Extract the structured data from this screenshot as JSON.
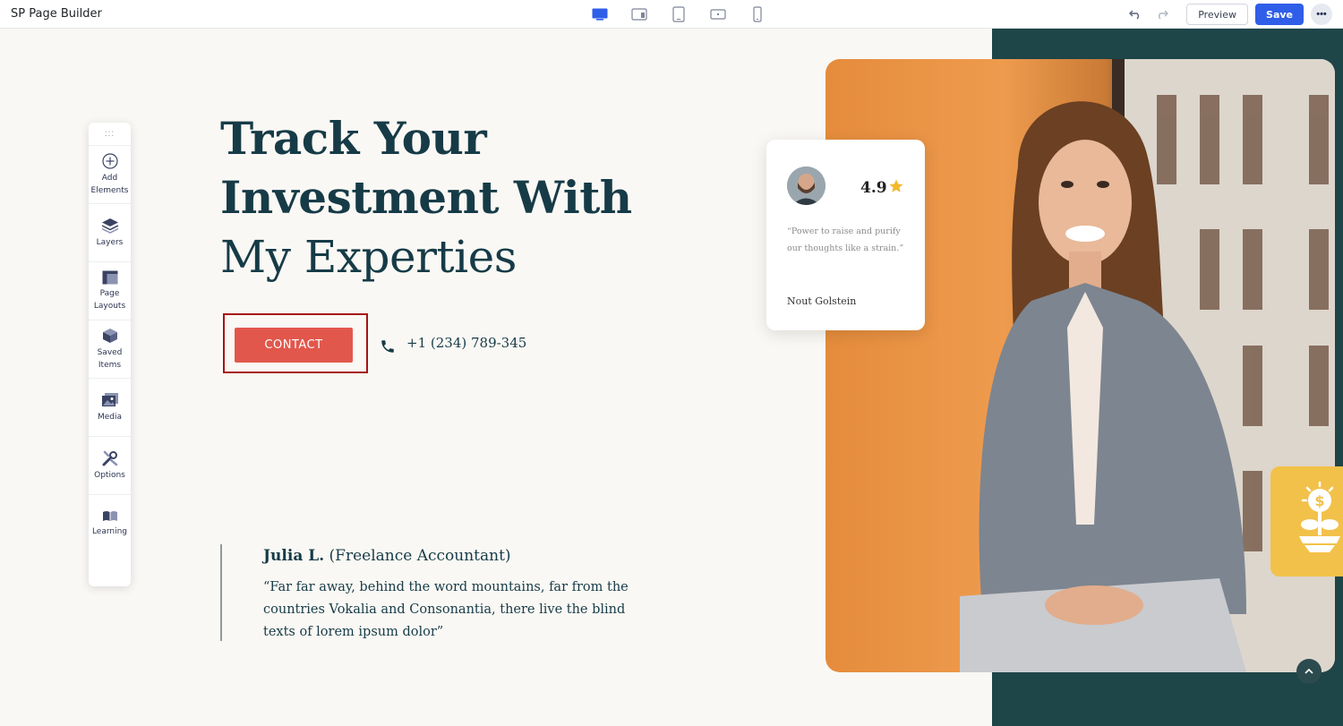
{
  "app": {
    "title": "SP Page Builder"
  },
  "devices": [
    "desktop-icon",
    "laptop-icon",
    "tablet-icon",
    "tablet-landscape-icon",
    "mobile-icon"
  ],
  "toolbar": {
    "preview_label": "Preview",
    "save_label": "Save",
    "more_label": "•••"
  },
  "sidebar": {
    "handle": ":::",
    "items": [
      {
        "label": "Add Elements",
        "icon": "plus-circle-icon"
      },
      {
        "label": "Layers",
        "icon": "layers-icon"
      },
      {
        "label": "Page Layouts",
        "icon": "layout-icon"
      },
      {
        "label": "Saved Items",
        "icon": "box-icon"
      },
      {
        "label": "Media",
        "icon": "media-icon"
      },
      {
        "label": "Options",
        "icon": "wrench-icon"
      },
      {
        "label": "Learning",
        "icon": "book-icon"
      }
    ]
  },
  "hero": {
    "line1": "Track Your",
    "line2": "Investment With",
    "line3": "My Experties",
    "contact_label": "CONTACT",
    "phone": "+1 (234) 789-345"
  },
  "testimonial": {
    "name": "Julia L.",
    "role": "(Freelance Accountant)",
    "text": "“Far far away, behind the word mountains, far from the countries Vokalia and Consonantia, there live the blind texts of lorem ipsum dolor”"
  },
  "review_card": {
    "rating": "4.9",
    "quote": "“Power to raise and purify our thoughts like a strain.”",
    "name": "Nout Golstein"
  },
  "colors": {
    "accent": "#e2574c",
    "brand_blue": "#2f5ee8",
    "teal": "#1e4548",
    "heading": "#163b47",
    "yellow": "#f2c14a"
  }
}
